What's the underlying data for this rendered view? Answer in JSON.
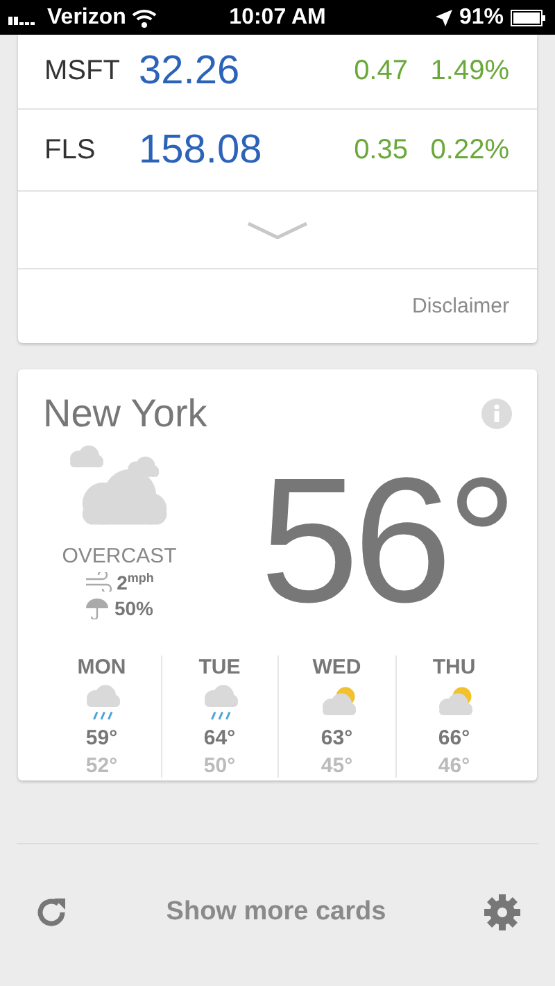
{
  "status_bar": {
    "carrier": "Verizon",
    "time": "10:07 AM",
    "battery": "91%"
  },
  "stocks": {
    "rows": [
      {
        "symbol": "MSFT",
        "price": "32.26",
        "change": "0.47",
        "percent": "1.49%"
      },
      {
        "symbol": "FLS",
        "price": "158.08",
        "change": "0.35",
        "percent": "0.22%"
      }
    ],
    "disclaimer": "Disclaimer"
  },
  "weather": {
    "city": "New York",
    "temperature": "56°",
    "condition": "OVERCAST",
    "wind": "2",
    "wind_unit": "mph",
    "precipitation": "50%",
    "forecast": [
      {
        "day": "MON",
        "kind": "rain",
        "high": "59°",
        "low": "52°"
      },
      {
        "day": "TUE",
        "kind": "rain",
        "high": "64°",
        "low": "50°"
      },
      {
        "day": "WED",
        "kind": "partly_sunny",
        "high": "63°",
        "low": "45°"
      },
      {
        "day": "THU",
        "kind": "partly_sunny",
        "high": "66°",
        "low": "46°"
      }
    ]
  },
  "footer": {
    "more": "Show more cards"
  }
}
